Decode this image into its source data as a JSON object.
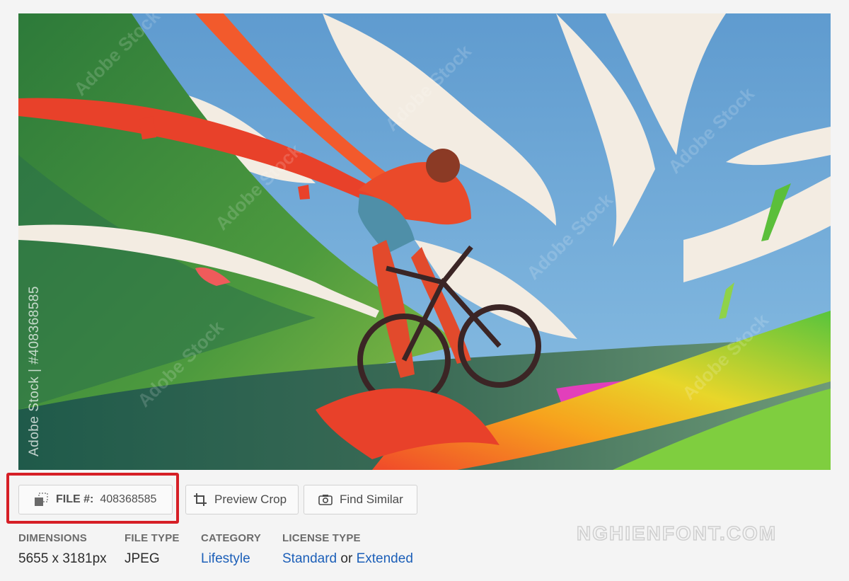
{
  "hero": {
    "side_watermark": "Adobe Stock | #408368585",
    "tile_watermark": "Adobe Stock",
    "colors": {
      "sky": "#6fa6d4",
      "grass": "#3f8a3e",
      "paint_red": "#e8412a",
      "paint_pink": "#e23fbb"
    }
  },
  "actions": {
    "file_label": "FILE #:",
    "file_number": "408368585",
    "preview_crop": "Preview Crop",
    "find_similar": "Find Similar",
    "highlight_color": "#d61f26"
  },
  "brand": "NGHIENFONT.COM",
  "meta": {
    "dimensions": {
      "label": "DIMENSIONS",
      "value": "5655 x 3181px"
    },
    "file_type": {
      "label": "FILE TYPE",
      "value": "JPEG"
    },
    "category": {
      "label": "CATEGORY",
      "value": "Lifestyle"
    },
    "license": {
      "label": "LICENSE TYPE",
      "standard": "Standard",
      "or": "or",
      "extended": "Extended"
    }
  }
}
